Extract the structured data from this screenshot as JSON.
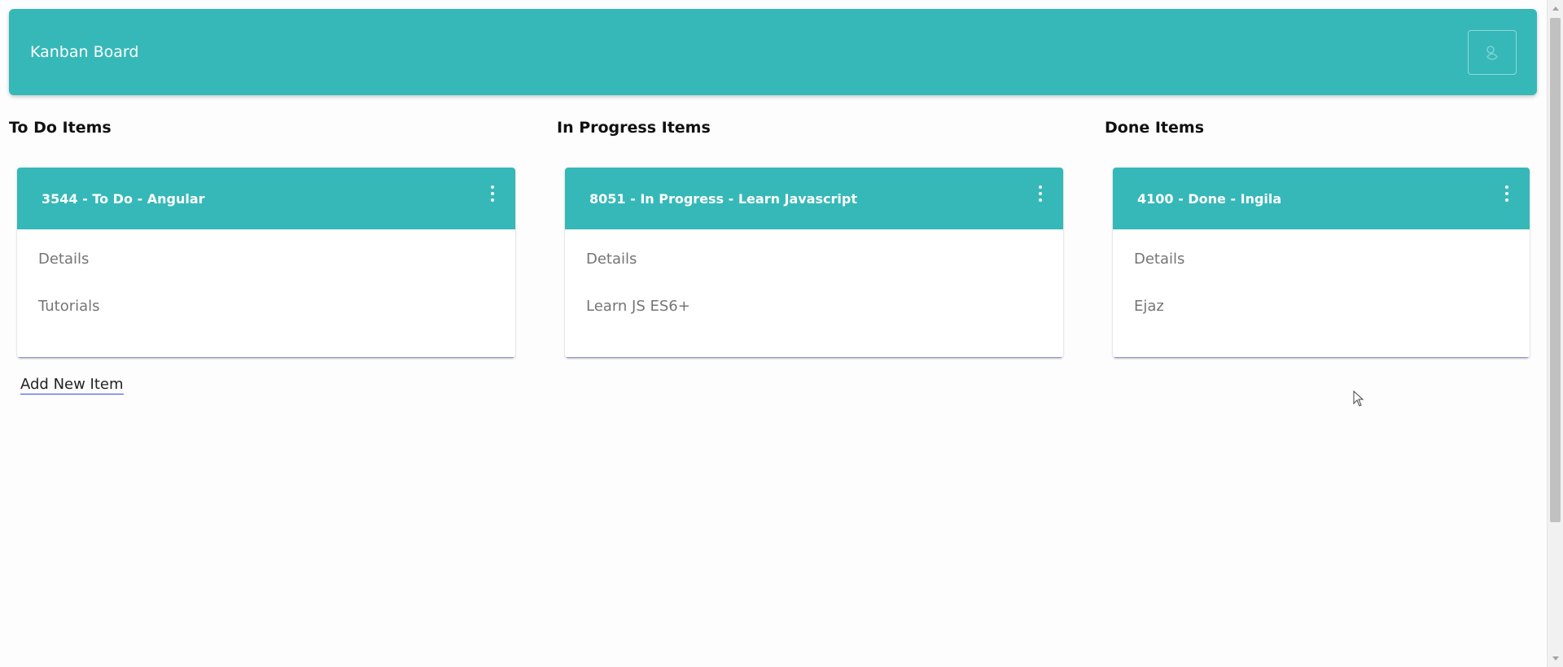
{
  "colors": {
    "accent": "#36b8b8",
    "header_text": "#ffffff",
    "muted_text": "#757575",
    "link_underline": "#3d47d6"
  },
  "header": {
    "title": "Kanban Board",
    "theme_toggle_icon": "theme-toggle-icon"
  },
  "columns": [
    {
      "title": "To Do Items",
      "card": {
        "title": "3544 - To Do - Angular",
        "details_label": "Details",
        "description": "Tutorials"
      },
      "add_label": "Add New Item"
    },
    {
      "title": "In Progress Items",
      "card": {
        "title": "8051 - In Progress - Learn Javascript",
        "details_label": "Details",
        "description": "Learn JS ES6+"
      }
    },
    {
      "title": "Done Items",
      "card": {
        "title": "4100 - Done - Ingila",
        "details_label": "Details",
        "description": "Ejaz"
      }
    }
  ]
}
